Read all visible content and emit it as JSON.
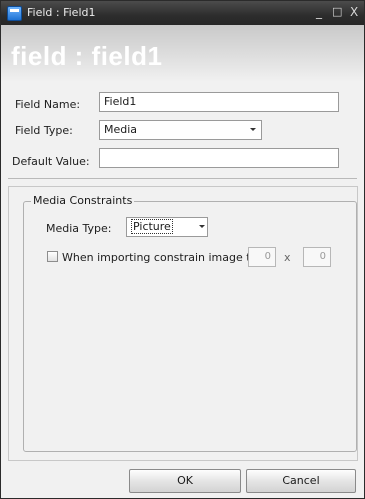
{
  "window": {
    "title": "Field : Field1",
    "controls": {
      "minimize": "_",
      "maximize": "□",
      "close": "X"
    }
  },
  "banner": {
    "title": "field : field1"
  },
  "form": {
    "field_name_label": "Field Name:",
    "field_name_value": "Field1",
    "field_type_label": "Field Type:",
    "field_type_value": "Media",
    "default_value_label": "Default Value:",
    "default_value_value": ""
  },
  "media_constraints": {
    "group_label": "Media Constraints",
    "media_type_label": "Media Type:",
    "media_type_value": "Picture",
    "constrain_label": "When importing constrain image to",
    "constrain_checked": false,
    "width_value": "0",
    "times_label": "x",
    "height_value": "0"
  },
  "buttons": {
    "ok": "OK",
    "cancel": "Cancel"
  },
  "icons": {
    "app": "window-app-icon",
    "dropdown": "chevron-down-icon"
  }
}
